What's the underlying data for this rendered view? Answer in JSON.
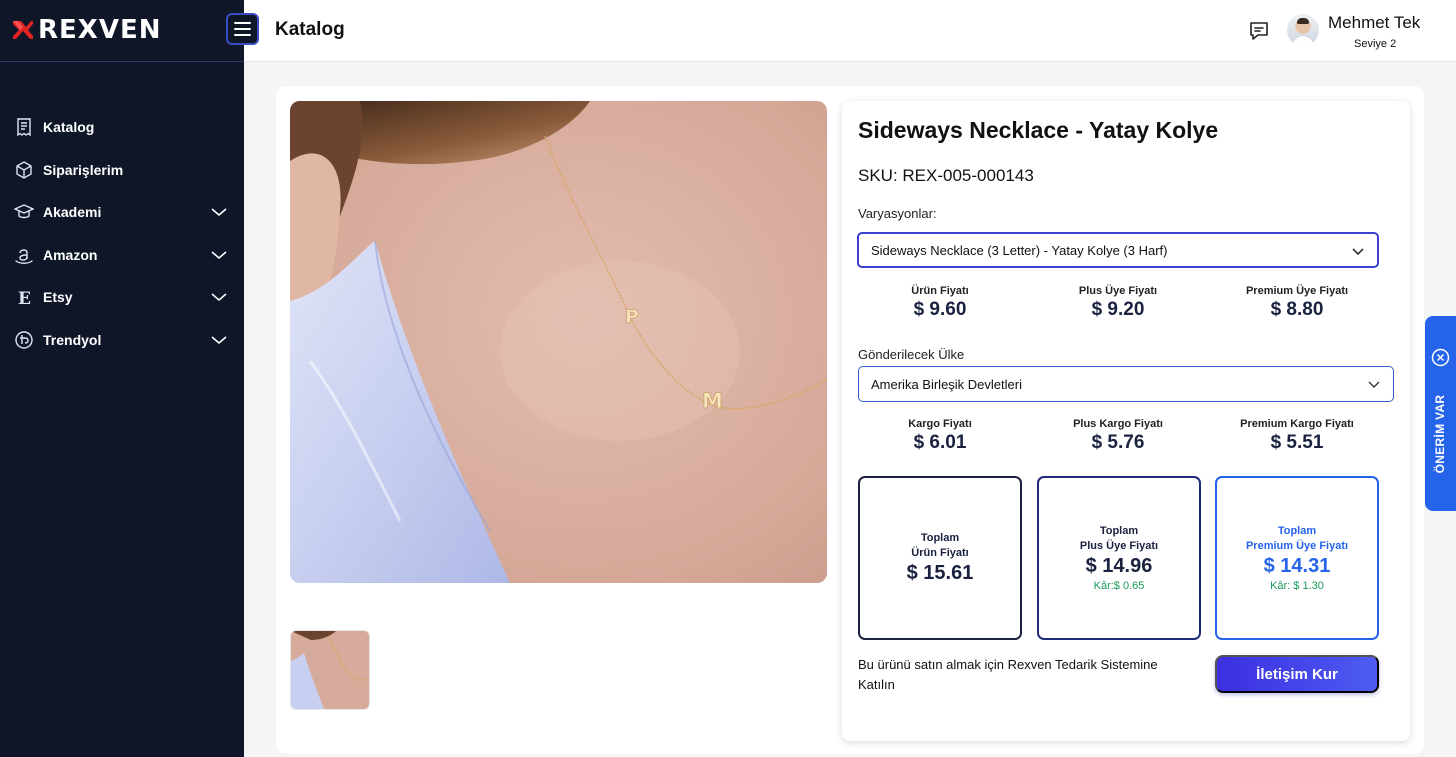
{
  "brand": {
    "name": "REXVEN",
    "accent": "#e02424"
  },
  "sidebar": {
    "items": [
      {
        "label": "Katalog",
        "icon": "receipt-icon",
        "has_submenu": false
      },
      {
        "label": "Siparişlerim",
        "icon": "box-icon",
        "has_submenu": false
      },
      {
        "label": "Akademi",
        "icon": "graduation-cap-icon",
        "has_submenu": true
      },
      {
        "label": "Amazon",
        "icon": "amazon-icon",
        "has_submenu": true
      },
      {
        "label": "Etsy",
        "icon": "etsy-icon",
        "has_submenu": true
      },
      {
        "label": "Trendyol",
        "icon": "trendyol-icon",
        "has_submenu": true
      }
    ]
  },
  "header": {
    "title": "Katalog",
    "user": {
      "name": "Mehmet Tek",
      "level": "Seviye 2"
    }
  },
  "product": {
    "title": "Sideways Necklace - Yatay Kolye",
    "sku": "SKU: REX-005-000143",
    "variations_label": "Varyasyonlar:",
    "variation_selected": "Sideways Necklace (3 Letter) - Yatay Kolye (3 Harf)",
    "prices": [
      {
        "label": "Ürün Fiyatı",
        "value": "$ 9.60"
      },
      {
        "label": "Plus Üye Fiyatı",
        "value": "$ 9.20"
      },
      {
        "label": "Premium Üye Fiyatı",
        "value": "$ 8.80"
      }
    ],
    "country_label": "Gönderilecek Ülke",
    "country_selected": "Amerika Birleşik Devletleri",
    "shipping": [
      {
        "label": "Kargo Fiyatı",
        "value": "$ 6.01"
      },
      {
        "label": "Plus Kargo Fiyatı",
        "value": "$ 5.76"
      },
      {
        "label": "Premium Kargo Fiyatı",
        "value": "$ 5.51"
      }
    ],
    "totals": [
      {
        "line1": "Toplam",
        "line2": "Ürün Fiyatı",
        "value": "$ 15.61",
        "profit": ""
      },
      {
        "line1": "Toplam",
        "line2": "Plus Üye Fiyatı",
        "value": "$ 14.96",
        "profit": "Kâr:$ 0.65"
      },
      {
        "line1": "Toplam",
        "line2": "Premium Üye Fiyatı",
        "value": "$ 14.31",
        "profit": "Kâr: $ 1.30"
      }
    ],
    "join_text": "Bu ürünü satın almak için Rexven Tedarik Sistemine Katılın",
    "contact_button": "İletişim Kur",
    "necklace_letters": [
      "P",
      "M"
    ]
  },
  "suggestion_tab": {
    "label": "ÖNERİM VAR"
  },
  "colors": {
    "sidebar_bg": "#0e1628",
    "primary_blue": "#2563eb",
    "button_gradient_start": "#3b2fe0",
    "profit_green": "#1a9a58"
  }
}
